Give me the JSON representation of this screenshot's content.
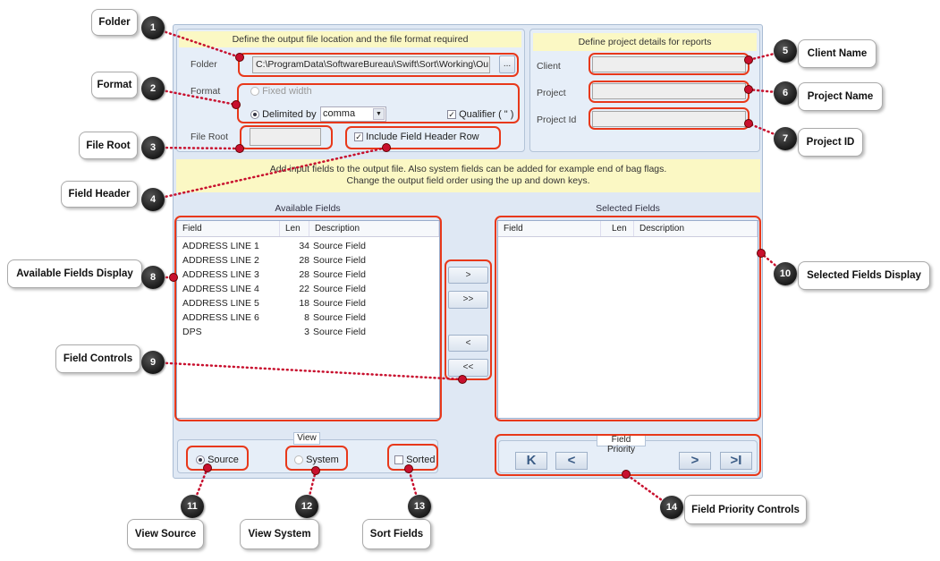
{
  "output_group": {
    "header": "Define the output file location and the file format required",
    "folder_label": "Folder",
    "folder_value": "C:\\ProgramData\\SoftwareBureau\\Swift\\Sort\\Working\\Ou",
    "browse_label": "...",
    "format_label": "Format",
    "fixed_width": "Fixed width",
    "delimited_by": "Delimited by",
    "delimiter": "comma",
    "qualifier": "Qualifier ( \" )",
    "file_root_label": "File Root",
    "file_root_value": "",
    "include_header": "Include Field Header Row"
  },
  "project_group": {
    "header": "Define project details for reports",
    "client_label": "Client",
    "project_label": "Project",
    "project_id_label": "Project Id"
  },
  "info": {
    "line1": "Add input fields to the output file.  Also system fields can be added for example end of bag flags.",
    "line2": "Change the output field order using the up and down keys."
  },
  "available": {
    "title": "Available Fields",
    "columns": [
      "Field",
      "Len",
      "Description"
    ],
    "rows": [
      [
        "ADDRESS LINE 1",
        "34",
        "Source Field"
      ],
      [
        "ADDRESS LINE 2",
        "28",
        "Source Field"
      ],
      [
        "ADDRESS LINE 3",
        "28",
        "Source Field"
      ],
      [
        "ADDRESS LINE 4",
        "22",
        "Source Field"
      ],
      [
        "ADDRESS LINE 5",
        "18",
        "Source Field"
      ],
      [
        "ADDRESS LINE 6",
        "8",
        "Source Field"
      ],
      [
        "DPS",
        "3",
        "Source Field"
      ]
    ]
  },
  "selected": {
    "title": "Selected Fields",
    "columns": [
      "Field",
      "Len",
      "Description"
    ]
  },
  "controls": {
    "add": ">",
    "add_all": ">>",
    "remove": "<",
    "remove_all": "<<"
  },
  "view": {
    "title": "View",
    "source": "Source",
    "system": "System",
    "sorted": "Sorted"
  },
  "priority": {
    "title": "Field Priority",
    "first": "K",
    "up": "<",
    "down": ">",
    "last": ">I"
  },
  "callouts": [
    {
      "n": "1",
      "label": "Folder"
    },
    {
      "n": "2",
      "label": "Format"
    },
    {
      "n": "3",
      "label": "File Root"
    },
    {
      "n": "4",
      "label": "Field Header"
    },
    {
      "n": "5",
      "label": "Client Name"
    },
    {
      "n": "6",
      "label": "Project Name"
    },
    {
      "n": "7",
      "label": "Project ID"
    },
    {
      "n": "8",
      "label": "Available Fields Display"
    },
    {
      "n": "9",
      "label": "Field Controls"
    },
    {
      "n": "10",
      "label": "Selected Fields Display"
    },
    {
      "n": "11",
      "label": "View Source"
    },
    {
      "n": "12",
      "label": "View System"
    },
    {
      "n": "13",
      "label": "Sort Fields"
    },
    {
      "n": "14",
      "label": "Field Priority Controls"
    }
  ],
  "colors": {
    "highlight": "#e8381a",
    "info_bg": "#fbf8c4",
    "window_bg": "#dfe8f4"
  }
}
